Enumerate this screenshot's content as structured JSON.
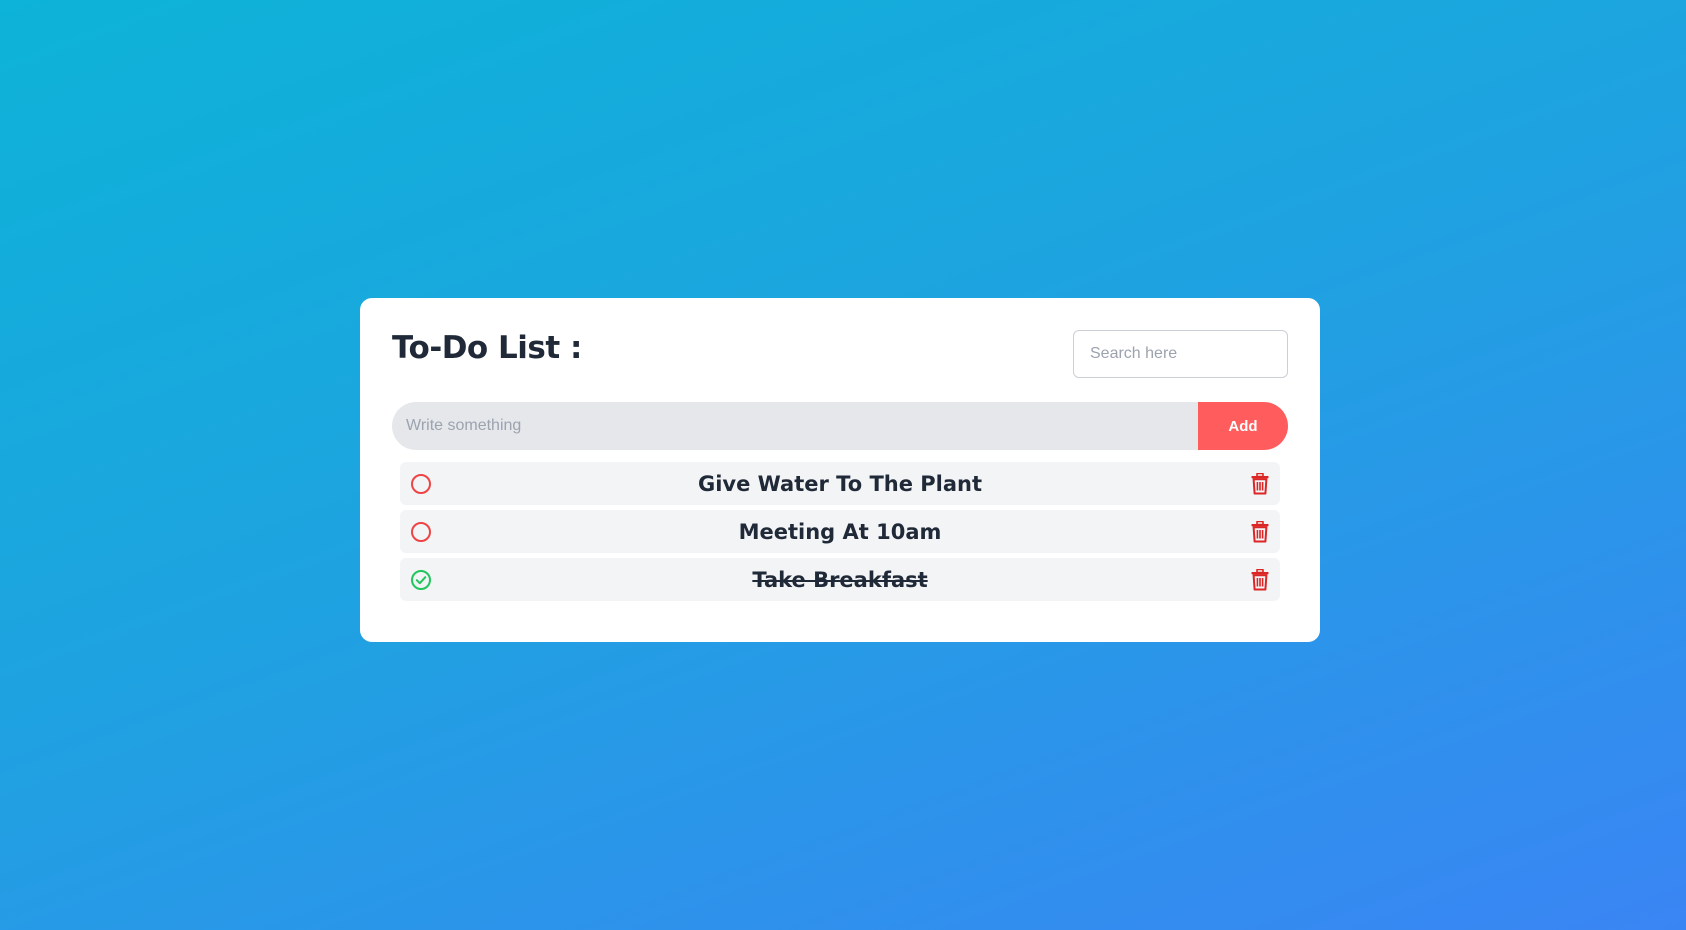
{
  "header": {
    "title": "To-Do List :",
    "search_placeholder": "Search here"
  },
  "composer": {
    "input_placeholder": "Write something",
    "add_label": "Add"
  },
  "tasks": [
    {
      "text": "Give Water To The Plant",
      "completed": false,
      "status_icon": "empty-circle-icon",
      "delete_icon": "trash-icon"
    },
    {
      "text": "Meeting At 10am",
      "completed": false,
      "status_icon": "empty-circle-icon",
      "delete_icon": "trash-icon"
    },
    {
      "text": "Take Breakfast",
      "completed": true,
      "status_icon": "check-circle-icon",
      "delete_icon": "trash-icon"
    }
  ],
  "colors": {
    "accent": "#ff5d5d",
    "pending": "#ef4444",
    "done": "#22c55e",
    "delete": "#dc2626"
  }
}
